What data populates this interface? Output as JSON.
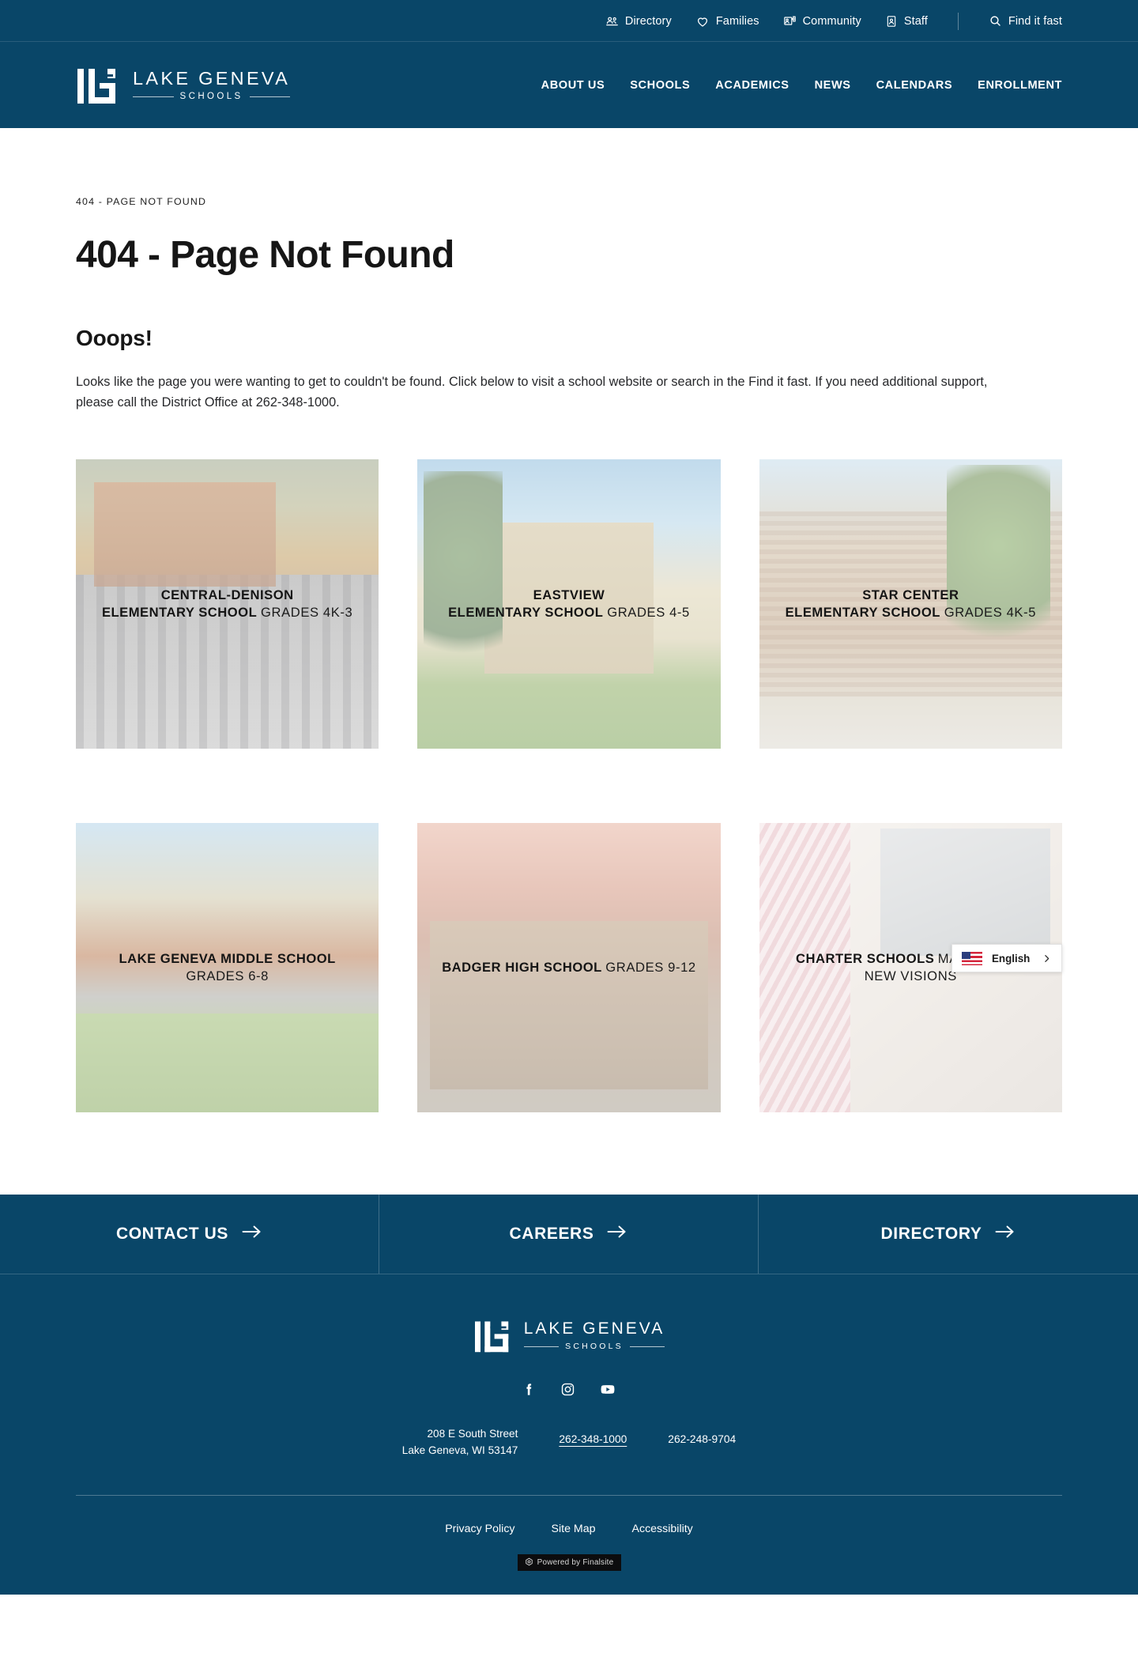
{
  "utility_bar": {
    "items": [
      {
        "label": "Directory",
        "icon": "people-icon"
      },
      {
        "label": "Families",
        "icon": "heart-icon"
      },
      {
        "label": "Community",
        "icon": "community-card-icon"
      },
      {
        "label": "Staff",
        "icon": "id-badge-icon"
      }
    ],
    "search": {
      "label": "Find it fast",
      "icon": "search-icon"
    }
  },
  "brand": {
    "title": "LAKE GENEVA",
    "subtitle": "SCHOOLS",
    "logo_icon": "lg-monogram-icon"
  },
  "nav": {
    "items": [
      {
        "label": "ABOUT US"
      },
      {
        "label": "SCHOOLS"
      },
      {
        "label": "ACADEMICS"
      },
      {
        "label": "NEWS"
      },
      {
        "label": "CALENDARS"
      },
      {
        "label": "ENROLLMENT"
      }
    ]
  },
  "main": {
    "breadcrumb": "404 - PAGE NOT FOUND",
    "page_title": "404 - Page Not Found",
    "sub_title": "Ooops!",
    "body": "Looks like the page you were wanting to get to couldn't be found. Click below to visit a school website or search in the Find it fast. If you need additional support, please call the District Office at 262-348-1000."
  },
  "schools": [
    {
      "name": "CENTRAL-DENISON\nELEMENTARY SCHOOL",
      "name_line1": "CENTRAL-DENISON",
      "name_line2": "ELEMENTARY SCHOOL",
      "grades_line1": "GRADES 4K-3",
      "grades_line2": "",
      "photo": "ph-cd"
    },
    {
      "name": "EASTVIEW ELEMENTARY SCHOOL",
      "name_line1": "EASTVIEW",
      "name_line2": "ELEMENTARY SCHOOL",
      "grades_line1": "GRADES 4-5",
      "grades_line2": "",
      "photo": "ph-ev"
    },
    {
      "name": "STAR CENTER ELEMENTARY SCHOOL",
      "name_line1": "STAR CENTER",
      "name_line2": "ELEMENTARY SCHOOL",
      "grades_line1": "GRADES 4K-5",
      "grades_line2": "",
      "photo": "ph-sc"
    },
    {
      "name": "LAKE GENEVA MIDDLE SCHOOL",
      "name_line1": "LAKE GENEVA MIDDLE SCHOOL",
      "name_line2": "",
      "grades_line1": "GRADES 6-8",
      "grades_line2": "",
      "photo": "ph-ms"
    },
    {
      "name": "BADGER HIGH SCHOOL",
      "name_line1": "BADGER HIGH SCHOOL",
      "name_line2": "",
      "grades_line1": "GRADES 9-12",
      "grades_line2": "",
      "photo": "ph-bh"
    },
    {
      "name": "CHARTER SCHOOLS",
      "name_line1": "CHARTER SCHOOLS",
      "name_line2": "",
      "grades_line1": "MAPLE PARK",
      "grades_line2": "NEW VISIONS",
      "photo": "ph-ch"
    }
  ],
  "language_widget": {
    "label": "English",
    "flag_icon": "us-flag-icon",
    "caret_icon": "chevron-right-icon"
  },
  "cta": {
    "items": [
      {
        "label": "CONTACT US",
        "icon": "arrow-right-icon"
      },
      {
        "label": "CAREERS",
        "icon": "arrow-right-icon"
      },
      {
        "label": "DIRECTORY",
        "icon": "arrow-right-icon"
      }
    ]
  },
  "footer": {
    "social": [
      {
        "name": "facebook-icon"
      },
      {
        "name": "instagram-icon"
      },
      {
        "name": "youtube-icon"
      }
    ],
    "address_line1": "208 E South Street",
    "address_line2": "Lake Geneva, WI  53147",
    "phone_primary": "262-348-1000",
    "phone_secondary": "262-248-9704",
    "legal_links": [
      {
        "label": "Privacy Policy"
      },
      {
        "label": "Site Map"
      },
      {
        "label": "Accessibility"
      }
    ],
    "powered_by": "Powered by Finalsite"
  },
  "colors": {
    "brand_navy": "#094668",
    "text_dark": "#161616",
    "white": "#ffffff"
  }
}
